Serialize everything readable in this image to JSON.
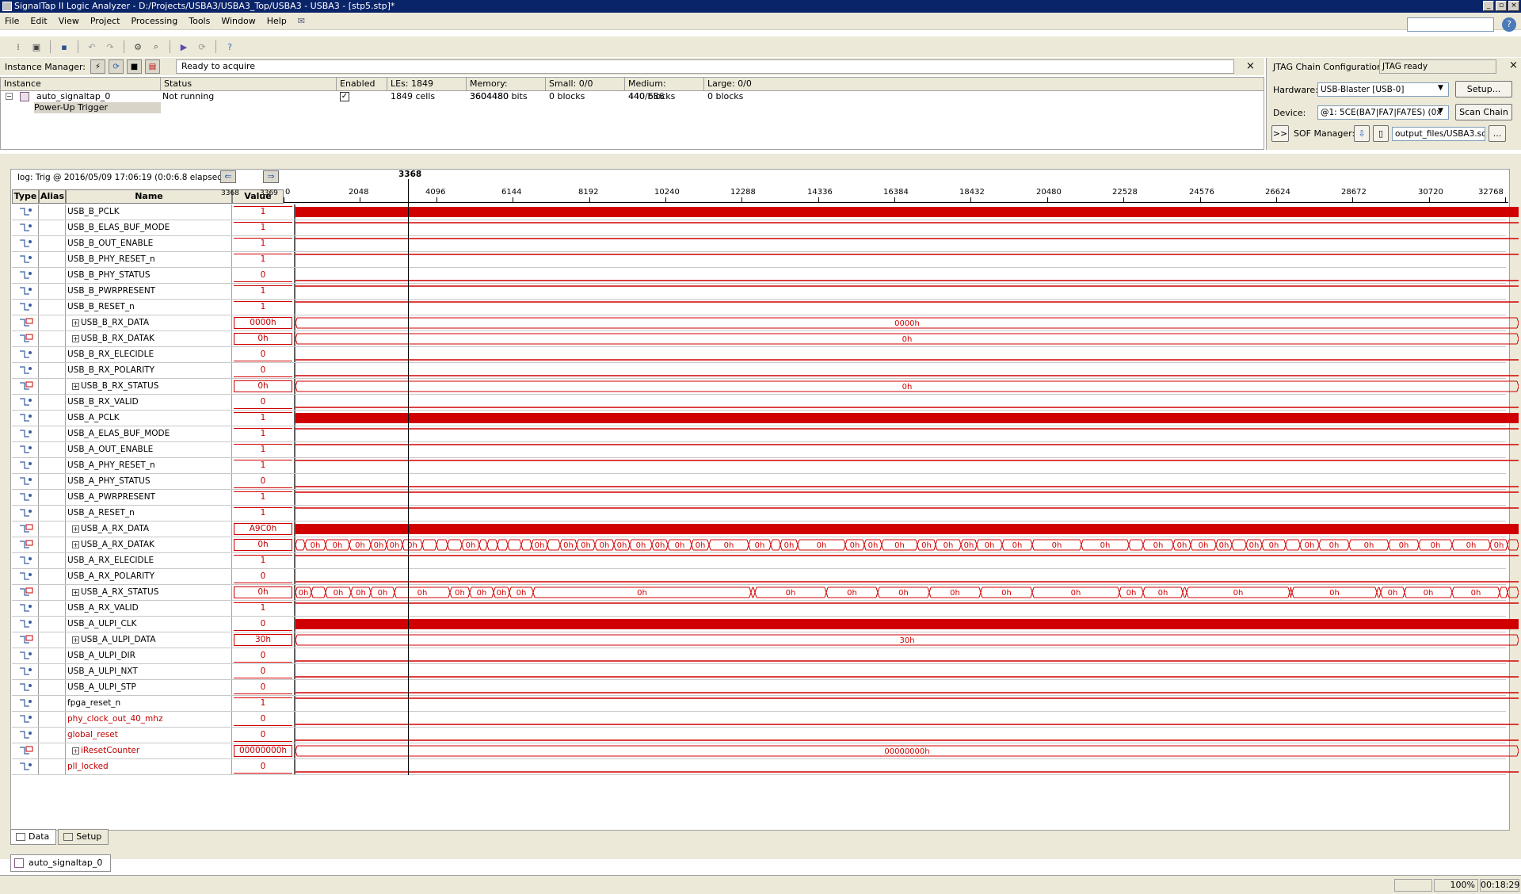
{
  "window": {
    "title": "SignalTap II Logic Analyzer - D:/Projects/USBA3/USBA3_Top/USBA3 - USBA3 - [stp5.stp]*"
  },
  "menu": [
    "File",
    "Edit",
    "View",
    "Project",
    "Processing",
    "Tools",
    "Window",
    "Help"
  ],
  "instance_manager": {
    "label": "Instance Manager:",
    "status": "Ready to acquire"
  },
  "instance_table": {
    "headers": [
      "Instance",
      "Status",
      "Enabled",
      "LEs: 1849",
      "Memory: 3604480",
      "Small: 0/0",
      "Medium: 440/686",
      "Large: 0/0"
    ],
    "row": {
      "instance": "auto_signaltap_0",
      "status": "Not running",
      "les": "1849 cells",
      "memory": "3604480 bits",
      "small": "0 blocks",
      "medium": "440 blocks",
      "large": "0 blocks"
    },
    "trigger": "Power-Up Trigger"
  },
  "jtag": {
    "label": "JTAG Chain Configuration:",
    "status": "JTAG ready",
    "hardware_label": "Hardware:",
    "hardware": "USB-Blaster [USB-0]",
    "setup": "Setup...",
    "device_label": "Device:",
    "device": "@1: 5CE(BA7|FA7|FA7ES) (0x",
    "scan_chain": "Scan Chain",
    "expand": ">>",
    "sof_label": "SOF Manager:",
    "sof_file": "output_files/USBA3.sof",
    "browse": "..."
  },
  "data_view": {
    "log": "log: Trig @ 2016/05/09 17:06:19 (0:0:6.8 elapsed)",
    "cursor": "3368",
    "value_range_left": "3368",
    "value_range_right": "3369",
    "headers": {
      "type": "Type",
      "alias": "Alias",
      "name": "Name",
      "value": "Value"
    },
    "ticks": [
      "0",
      "2048",
      "4096",
      "6144",
      "8192",
      "10240",
      "12288",
      "14336",
      "16384",
      "18432",
      "20480",
      "22528",
      "24576",
      "26624",
      "28672",
      "30720",
      "32768"
    ]
  },
  "signals": [
    {
      "name": "USB_B_PCLK",
      "value": "1",
      "kind": "clock",
      "color": "black"
    },
    {
      "name": "USB_B_ELAS_BUF_MODE",
      "value": "1",
      "kind": "high",
      "color": "black"
    },
    {
      "name": "USB_B_OUT_ENABLE",
      "value": "1",
      "kind": "high",
      "color": "black"
    },
    {
      "name": "USB_B_PHY_RESET_n",
      "value": "1",
      "kind": "high",
      "color": "black"
    },
    {
      "name": "USB_B_PHY_STATUS",
      "value": "0",
      "kind": "low",
      "color": "black"
    },
    {
      "name": "USB_B_PWRPRESENT",
      "value": "1",
      "kind": "high",
      "color": "black"
    },
    {
      "name": "USB_B_RESET_n",
      "value": "1",
      "kind": "high",
      "color": "black"
    },
    {
      "name": "USB_B_RX_DATA",
      "value": "0000h",
      "kind": "bus",
      "bus_label": "0000h",
      "color": "black"
    },
    {
      "name": "USB_B_RX_DATAK",
      "value": "0h",
      "kind": "bus",
      "bus_label": "0h",
      "color": "black"
    },
    {
      "name": "USB_B_RX_ELECIDLE",
      "value": "0",
      "kind": "low",
      "color": "black"
    },
    {
      "name": "USB_B_RX_POLARITY",
      "value": "0",
      "kind": "low",
      "color": "black"
    },
    {
      "name": "USB_B_RX_STATUS",
      "value": "0h",
      "kind": "bus",
      "bus_label": "0h",
      "color": "black"
    },
    {
      "name": "USB_B_RX_VALID",
      "value": "0",
      "kind": "low",
      "color": "black"
    },
    {
      "name": "USB_A_PCLK",
      "value": "1",
      "kind": "clock",
      "color": "black"
    },
    {
      "name": "USB_A_ELAS_BUF_MODE",
      "value": "1",
      "kind": "high",
      "color": "black"
    },
    {
      "name": "USB_A_OUT_ENABLE",
      "value": "1",
      "kind": "high",
      "color": "black"
    },
    {
      "name": "USB_A_PHY_RESET_n",
      "value": "1",
      "kind": "high",
      "color": "black"
    },
    {
      "name": "USB_A_PHY_STATUS",
      "value": "0",
      "kind": "low",
      "color": "black"
    },
    {
      "name": "USB_A_PWRPRESENT",
      "value": "1",
      "kind": "high",
      "color": "black"
    },
    {
      "name": "USB_A_RESET_n",
      "value": "1",
      "kind": "high",
      "color": "black"
    },
    {
      "name": "USB_A_RX_DATA",
      "value": "A9C0h",
      "kind": "busdense",
      "color": "black"
    },
    {
      "name": "USB_A_RX_DATAK",
      "value": "0h",
      "kind": "bussegs",
      "seg": "datak",
      "color": "black"
    },
    {
      "name": "USB_A_RX_ELECIDLE",
      "value": "1",
      "kind": "high",
      "color": "black"
    },
    {
      "name": "USB_A_RX_POLARITY",
      "value": "0",
      "kind": "low",
      "color": "black"
    },
    {
      "name": "USB_A_RX_STATUS",
      "value": "0h",
      "kind": "bussegs",
      "seg": "status",
      "color": "black"
    },
    {
      "name": "USB_A_RX_VALID",
      "value": "1",
      "kind": "high",
      "color": "black"
    },
    {
      "name": "USB_A_ULPI_CLK",
      "value": "0",
      "kind": "clock",
      "color": "black"
    },
    {
      "name": "USB_A_ULPI_DATA",
      "value": "30h",
      "kind": "bus",
      "bus_label": "30h",
      "color": "black"
    },
    {
      "name": "USB_A_ULPI_DIR",
      "value": "0",
      "kind": "low",
      "color": "black"
    },
    {
      "name": "USB_A_ULPI_NXT",
      "value": "0",
      "kind": "low",
      "color": "black"
    },
    {
      "name": "USB_A_ULPI_STP",
      "value": "0",
      "kind": "low",
      "color": "black"
    },
    {
      "name": "fpga_reset_n",
      "value": "1",
      "kind": "high",
      "color": "black"
    },
    {
      "name": "phy_clock_out_40_mhz",
      "value": "0",
      "kind": "low",
      "color": "red"
    },
    {
      "name": "global_reset",
      "value": "0",
      "kind": "low",
      "color": "red"
    },
    {
      "name": "iResetCounter",
      "value": "00000000h",
      "kind": "bus",
      "bus_label": "00000000h",
      "color": "red"
    },
    {
      "name": "pll_locked",
      "value": "0",
      "kind": "low",
      "color": "red"
    }
  ],
  "tabs": {
    "data": "Data",
    "setup": "Setup"
  },
  "instance_tab": "auto_signaltap_0",
  "statusbar": {
    "zoom": "100%",
    "time": "00:18:29"
  }
}
